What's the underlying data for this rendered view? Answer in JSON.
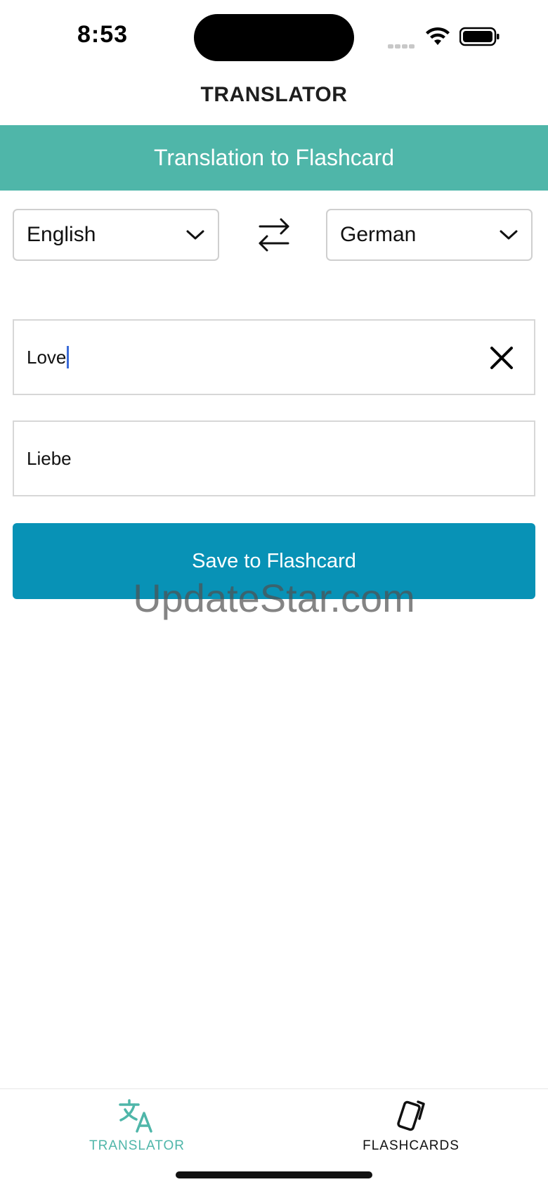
{
  "status_bar": {
    "time": "8:53",
    "icons": [
      "signal-icon",
      "wifi-icon",
      "battery-icon"
    ]
  },
  "header": {
    "title": "TRANSLATOR"
  },
  "banner": {
    "text": "Translation to Flashcard",
    "color": "#4fb6a9"
  },
  "languages": {
    "source": "English",
    "target": "German"
  },
  "input": {
    "value": "Love"
  },
  "output": {
    "value": "Liebe"
  },
  "actions": {
    "save_label": "Save to Flashcard",
    "save_color": "#0892b6"
  },
  "watermark": {
    "text": "UpdateStar.com"
  },
  "tab_bar": {
    "tabs": [
      {
        "label": "TRANSLATOR",
        "icon": "translate-icon",
        "active": true
      },
      {
        "label": "FLASHCARDS",
        "icon": "cards-icon",
        "active": false
      }
    ],
    "active_color": "#4fb6a9"
  }
}
